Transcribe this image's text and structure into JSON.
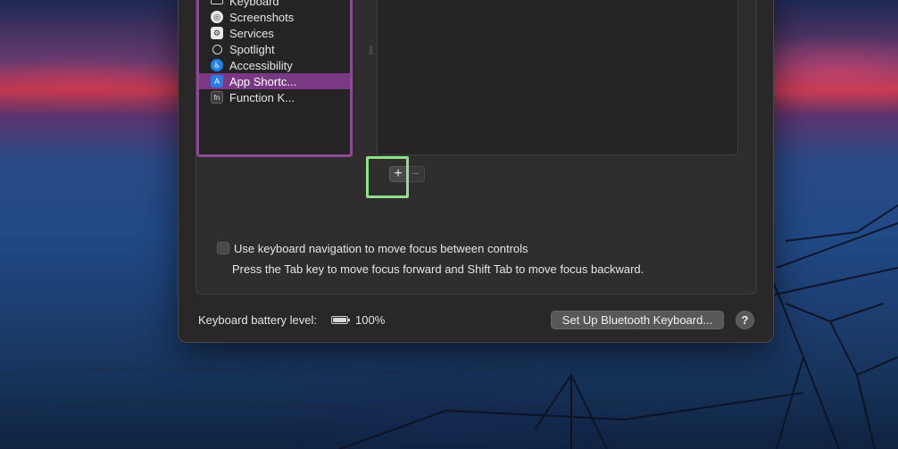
{
  "sidebar": {
    "items": [
      {
        "label": "Keyboard",
        "icon": "keyboard-icon",
        "selected": false
      },
      {
        "label": "Screenshots",
        "icon": "screenshot-icon",
        "selected": false
      },
      {
        "label": "Services",
        "icon": "gear-icon",
        "selected": false
      },
      {
        "label": "Spotlight",
        "icon": "magnifier-icon",
        "selected": false
      },
      {
        "label": "Accessibility",
        "icon": "accessibility-icon",
        "selected": false
      },
      {
        "label": "App Shortc...",
        "icon": "app-store-icon",
        "selected": true
      },
      {
        "label": "Function K...",
        "icon": "fn-key-icon",
        "selected": false
      }
    ]
  },
  "shortcut_controls": {
    "add_label": "+",
    "remove_label": "−"
  },
  "keyboard_navigation": {
    "checkbox_label": "Use keyboard navigation to move focus between controls",
    "checked": false,
    "hint": "Press the Tab key to move focus forward and Shift Tab to move focus backward."
  },
  "footer": {
    "battery_label": "Keyboard battery level:",
    "battery_percent": "100%",
    "bluetooth_button": "Set Up Bluetooth Keyboard...",
    "help_button": "?"
  },
  "colors": {
    "selection": "#7b3985",
    "list_border": "#8b4c93",
    "focus_ring": "#8fe08a",
    "window_bg": "#2a2728"
  }
}
